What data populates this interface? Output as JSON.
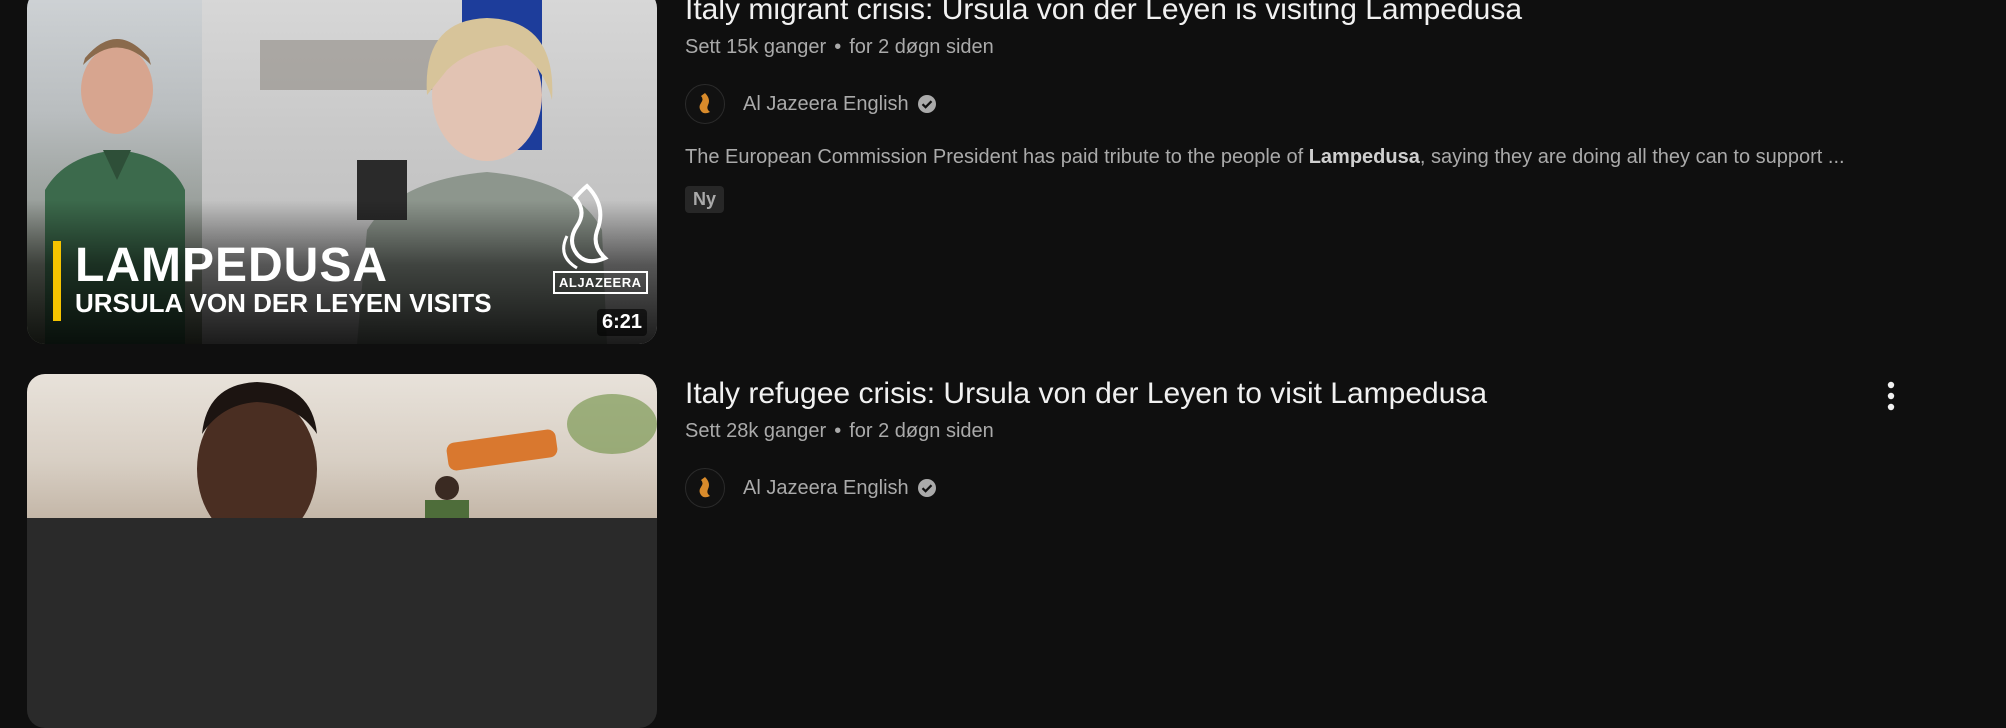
{
  "results": [
    {
      "title": "Italy migrant crisis: Ursula von der Leyen is visiting Lampedusa",
      "views": "Sett 15k ganger",
      "separator": "•",
      "age": "for 2 døgn siden",
      "channel": "Al Jazeera English",
      "description_before": "The European Commission President has paid tribute to the people of ",
      "description_bold": "Lampedusa",
      "description_after": ", saying they are doing all they can to support ...",
      "badge": "Ny",
      "duration": "6:21",
      "thumb_text_1": "LAMPEDUSA",
      "thumb_text_2": "URSULA VON DER LEYEN VISITS",
      "thumb_logo_text": "ALJAZEERA"
    },
    {
      "title": "Italy refugee crisis: Ursula von der Leyen to visit Lampedusa",
      "views": "Sett 28k ganger",
      "separator": "•",
      "age": "for 2 døgn siden",
      "channel": "Al Jazeera English"
    }
  ],
  "icons": {
    "verified": "verified-check-icon",
    "more": "more-vert-icon",
    "channel_avatar": "al-jazeera-logo-icon"
  },
  "colors": {
    "background": "#0f0f0f",
    "accent_bar": "#f5c400"
  }
}
